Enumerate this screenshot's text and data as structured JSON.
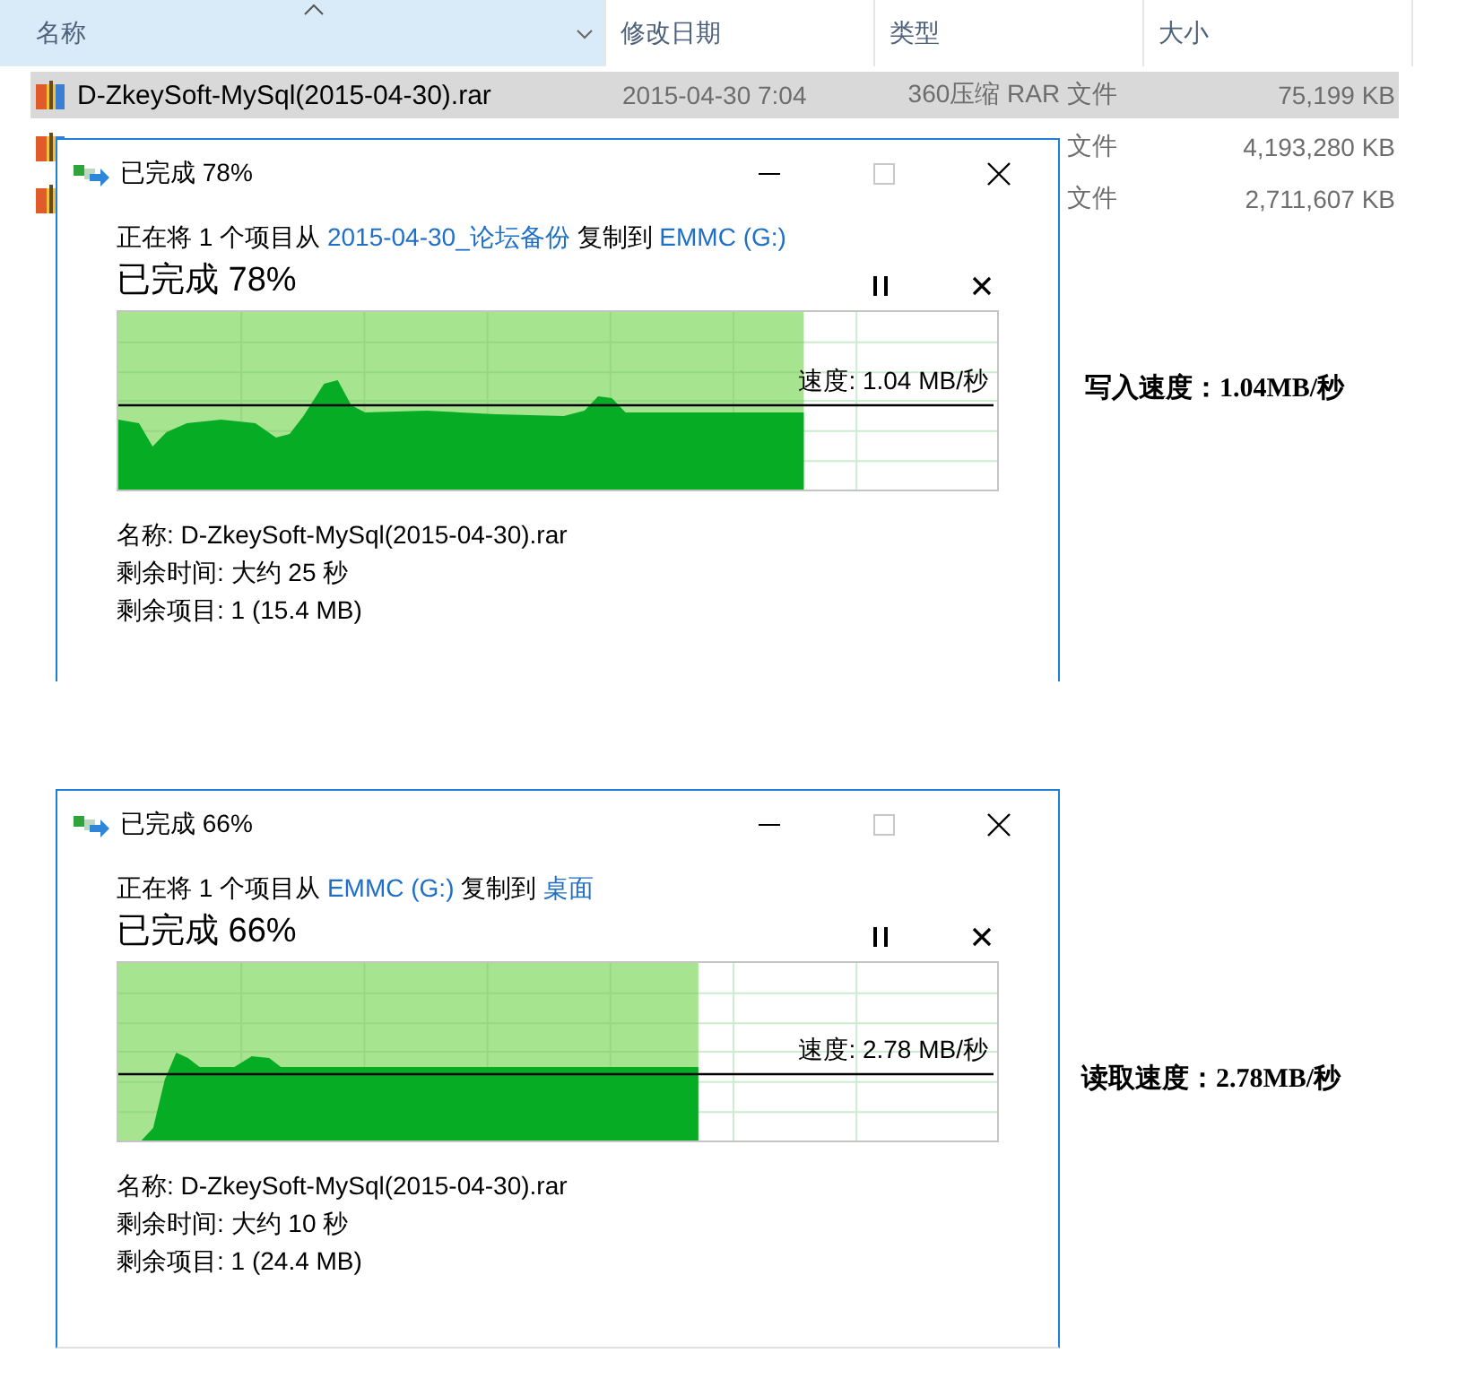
{
  "explorer": {
    "columns": [
      {
        "label": "名称",
        "sorted": true
      },
      {
        "label": "修改日期",
        "sorted": false
      },
      {
        "label": "类型",
        "sorted": false
      },
      {
        "label": "大小",
        "sorted": false
      }
    ],
    "rows": [
      {
        "name": "D-ZkeySoft-MySql(2015-04-30).rar",
        "modified": "2015-04-30 7:04",
        "type": "360压缩 RAR 文件",
        "size": "75,199 KB",
        "selected": true
      },
      {
        "type": "文件",
        "size": "4,193,280 KB",
        "selected": false
      },
      {
        "type": "文件",
        "size": "2,711,607 KB",
        "selected": false
      }
    ]
  },
  "dialogs": [
    {
      "title": "已完成 78%",
      "description": [
        {
          "text": "正在将 1 个项目从 ",
          "link": false
        },
        {
          "text": "2015-04-30_论坛备份",
          "link": true
        },
        {
          "text": " 复制到 ",
          "link": false
        },
        {
          "text": "EMMC (G:)",
          "link": true
        }
      ],
      "progress_label": "已完成 78%",
      "level": 0.78,
      "speed": "速度: 1.04 MB/秒",
      "name": "名称: D-ZkeySoft-MySql(2015-04-30).rar",
      "time_left": "剩余时间: 大约 25 秒",
      "items_left": "剩余项目: 1 (15.4 MB)",
      "caption": "写入速度：1.04MB/秒"
    },
    {
      "title": "已完成 66%",
      "description": [
        {
          "text": "正在将 1 个项目从 ",
          "link": false
        },
        {
          "text": "EMMC (G:)",
          "link": true
        },
        {
          "text": " 复制到 ",
          "link": false
        },
        {
          "text": "桌面",
          "link": true
        }
      ],
      "progress_label": "已完成 66%",
      "level": 0.66,
      "speed": "速度: 2.78 MB/秒",
      "name": "名称: D-ZkeySoft-MySql(2015-04-30).rar",
      "time_left": "剩余时间: 大约 10 秒",
      "items_left": "剩余项目: 1 (24.4 MB)",
      "caption": "读取速度：2.78MB/秒"
    }
  ]
}
